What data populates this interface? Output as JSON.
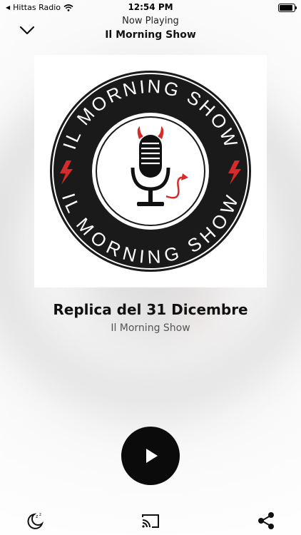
{
  "status_bar": {
    "back_app": "Hittas Radio",
    "time": "12:54 PM"
  },
  "header": {
    "now_playing": "Now Playing",
    "title": "Il Morning Show"
  },
  "artwork": {
    "logo_text_top": "IL MORNING SHOW",
    "logo_text_bottom": "IL MORNING SHOW",
    "colors": {
      "ring": "#1a1a1a",
      "accent": "#d62b2b"
    }
  },
  "track": {
    "title": "Replica del 31 Dicembre",
    "subtitle": "Il Morning Show"
  },
  "controls": {
    "play_icon": "play-icon"
  },
  "bottom_bar": {
    "left_icon": "sleep-timer-icon",
    "center_icon": "cast-icon",
    "right_icon": "share-icon"
  }
}
